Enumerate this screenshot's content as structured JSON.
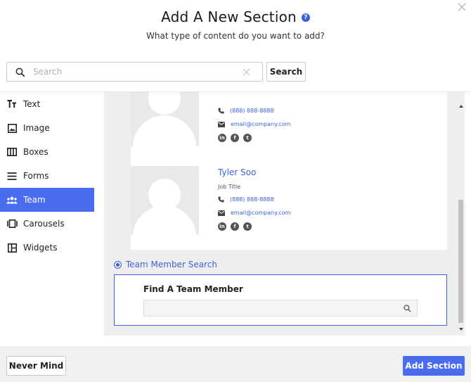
{
  "dialog": {
    "title": "Add A New Section",
    "subtitle": "What type of content do you want to add?",
    "help_icon": "question-circle-icon",
    "close_icon": "close-icon"
  },
  "search": {
    "placeholder": "Search",
    "value": "",
    "button_label": "Search"
  },
  "sidebar": {
    "items": [
      {
        "label": "Text",
        "icon": "text-format-icon",
        "active": false
      },
      {
        "label": "Image",
        "icon": "image-icon",
        "active": false
      },
      {
        "label": "Boxes",
        "icon": "boxes-icon",
        "active": false
      },
      {
        "label": "Forms",
        "icon": "forms-icon",
        "active": false
      },
      {
        "label": "Team",
        "icon": "team-icon",
        "active": true
      },
      {
        "label": "Carousels",
        "icon": "carousel-icon",
        "active": false
      },
      {
        "label": "Widgets",
        "icon": "widgets-icon",
        "active": false
      }
    ]
  },
  "preview": {
    "members": [
      {
        "name": "",
        "job_title": "",
        "phone": "(888) 888-8888",
        "email": "email@company.com",
        "socials": [
          "linkedin-icon",
          "facebook-icon",
          "twitter-icon"
        ]
      },
      {
        "name": "Tyler Soo",
        "job_title": "Job Title",
        "phone": "(888) 888-8888",
        "email": "email@company.com",
        "socials": [
          "linkedin-icon",
          "facebook-icon",
          "twitter-icon"
        ]
      }
    ],
    "option_label": "Team Member Search",
    "find_title": "Find A Team Member",
    "find_placeholder": ""
  },
  "footer": {
    "cancel_label": "Never Mind",
    "submit_label": "Add Section"
  },
  "colors": {
    "accent": "#4a6cf0",
    "link": "#3d5fe0",
    "panel_bg": "#eeeeee",
    "footer_bg": "#f0f0f0"
  }
}
